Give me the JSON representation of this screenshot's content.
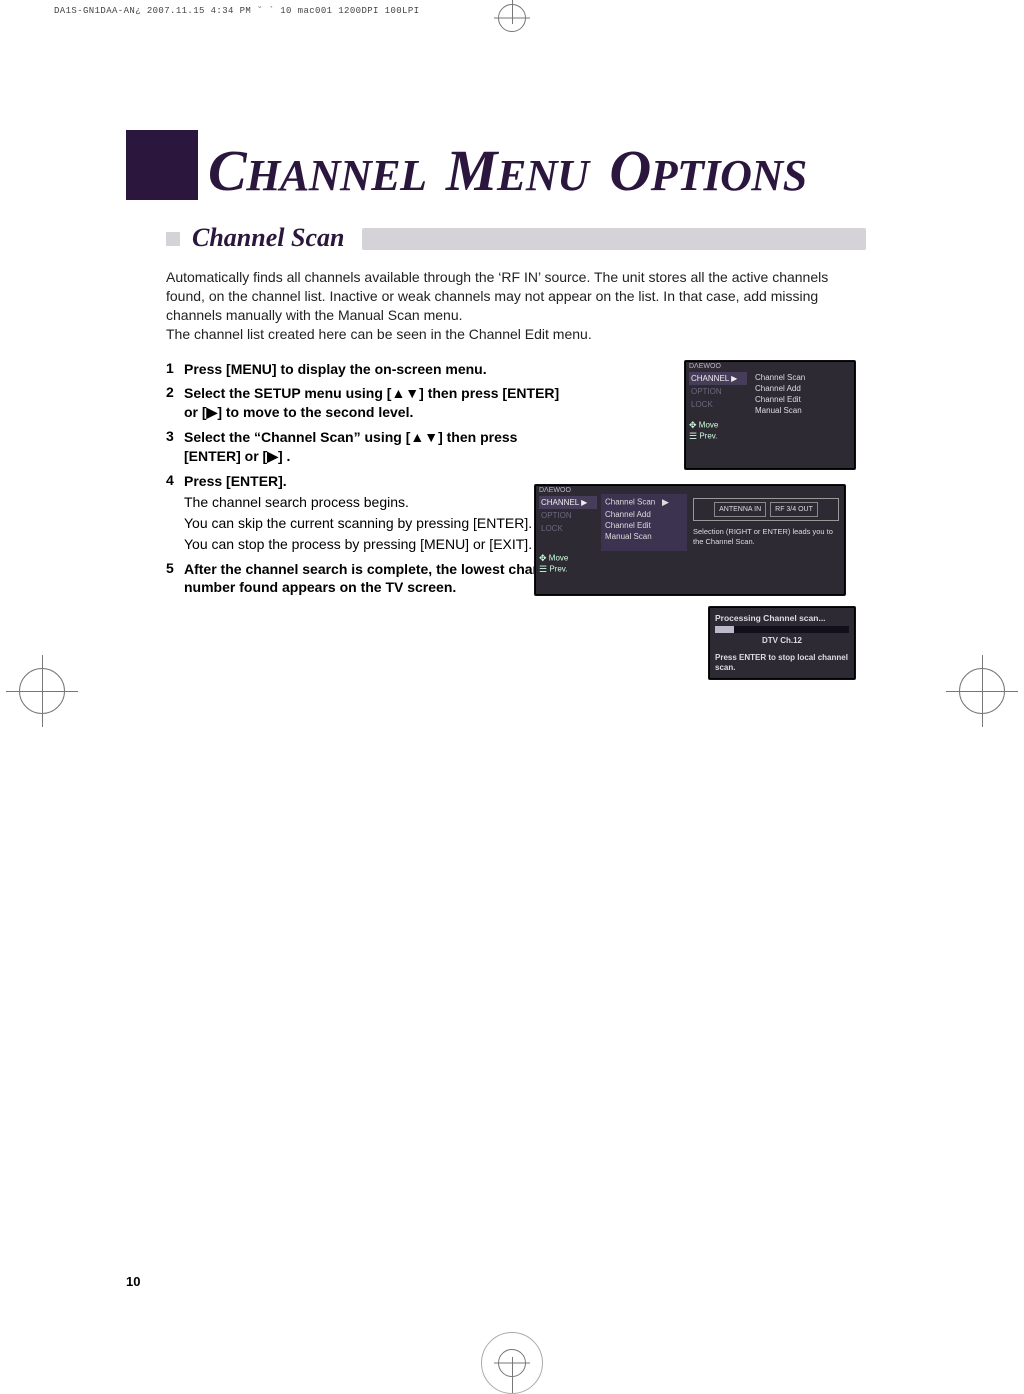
{
  "meta": {
    "header_line": "DA1S-GN1DAA-AN¿   2007.11.15 4:34 PM  ˘ ` 10   mac001  1200DPI 100LPI"
  },
  "title": {
    "word1_cap": "C",
    "word1_rest": "HANNEL",
    "word2_cap": "M",
    "word2_rest": "ENU",
    "word3_cap": "O",
    "word3_rest": "PTIONS"
  },
  "section": {
    "heading": "Channel Scan"
  },
  "intro": {
    "p1": "Automatically finds all channels available through the ‘RF IN’ source. The unit stores all the active channels found, on the channel list. Inactive or weak channels may not appear on the list. In that case, add missing channels manually with the Manual Scan menu.",
    "p2": "The channel list created here can be seen in the Channel Edit menu."
  },
  "steps": {
    "s1": {
      "n": "1",
      "t": "Press [MENU] to display the on-screen menu."
    },
    "s2": {
      "n": "2",
      "t": "Select the SETUP menu using [▲▼] then press [ENTER] or [▶] to move to the second level."
    },
    "s3": {
      "n": "3",
      "t": "Select the “Channel Scan” using [▲▼] then press [ENTER] or [▶] ."
    },
    "s4": {
      "n": "4",
      "t": "Press [ENTER].",
      "sub1": "The channel search process begins.",
      "sub2": "You can skip the current scanning by pressing [ENTER].",
      "sub3": "You can stop the process by pressing [MENU] or [EXIT]."
    },
    "s5": {
      "n": "5",
      "t": "After the channel search is complete, the lowest channel number found appears on the TV screen."
    }
  },
  "osd1": {
    "brand": "DΛEWOO",
    "left": {
      "channel": "CHANNEL ▶",
      "option": "OPTION",
      "lock": "LOCK"
    },
    "right": {
      "r1": "Channel Scan",
      "r2": "Channel Add",
      "r3": "Channel Edit",
      "r4": "Manual Scan"
    },
    "foot": {
      "move": "Move",
      "prev": "Prev."
    }
  },
  "osd2": {
    "brand": "DΛEWOO",
    "left": {
      "channel": "CHANNEL ▶",
      "option": "OPTION",
      "lock": "LOCK"
    },
    "mid": {
      "m1": "Channel Scan",
      "m2": "Channel Add",
      "m3": "Channel Edit",
      "m4": "Manual Scan",
      "arrow": "▶"
    },
    "antenna": {
      "a1": "ANTENNA IN",
      "a2": "RF 3/4 OUT"
    },
    "desc": "Selection (RIGHT or ENTER) leads you to the Channel Scan.",
    "foot": {
      "move": "Move",
      "prev": "Prev."
    }
  },
  "osd3": {
    "l1": "Processing Channel scan...",
    "ch": "DTV Ch.12",
    "hint": "Press ENTER to stop local channel scan."
  },
  "pagenum": "10"
}
